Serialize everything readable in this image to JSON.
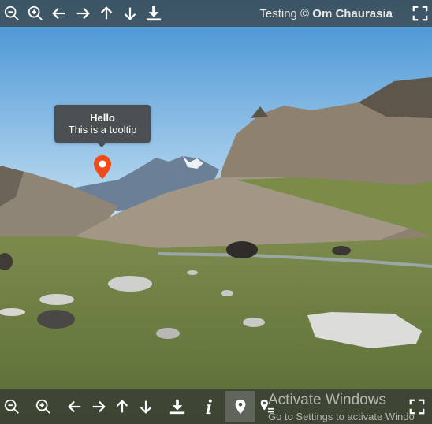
{
  "window": {
    "caption_prefix": "Testing ©",
    "caption_author": "Om Chaurasia"
  },
  "top_toolbar": [
    {
      "name": "zoom-out-button",
      "icon": "zoom-out-icon"
    },
    {
      "name": "zoom-in-button",
      "icon": "zoom-in-icon"
    },
    {
      "name": "move-left-button",
      "icon": "arrow-left-icon"
    },
    {
      "name": "move-right-button",
      "icon": "arrow-right-icon"
    },
    {
      "name": "move-up-button",
      "icon": "arrow-up-icon"
    },
    {
      "name": "move-down-button",
      "icon": "arrow-down-icon"
    },
    {
      "name": "download-button",
      "icon": "download-icon"
    },
    {
      "name": "fullscreen-button",
      "icon": "fullscreen-icon"
    }
  ],
  "bottom_toolbar": [
    {
      "name": "zoom-out-button",
      "icon": "zoom-out-icon"
    },
    {
      "name": "zoom-in-button",
      "icon": "zoom-in-icon"
    },
    {
      "name": "move-left-button",
      "icon": "arrow-left-icon"
    },
    {
      "name": "move-right-button",
      "icon": "arrow-right-icon"
    },
    {
      "name": "move-up-button",
      "icon": "arrow-up-icon"
    },
    {
      "name": "move-down-button",
      "icon": "arrow-down-icon"
    },
    {
      "name": "download-button",
      "icon": "download-icon"
    },
    {
      "name": "info-button",
      "icon": "info-icon"
    },
    {
      "name": "markers-button",
      "icon": "marker-icon",
      "active": true
    },
    {
      "name": "markers-list-button",
      "icon": "marker-list-icon"
    },
    {
      "name": "fullscreen-button",
      "icon": "fullscreen-icon"
    }
  ],
  "tooltip": {
    "title": "Hello",
    "body": "This is a tooltip"
  },
  "marker": {
    "icon": "map-pin-icon",
    "color": "#f04a1a"
  },
  "os_watermark": {
    "title": "Activate Windows",
    "subtitle": "Go to Settings to activate Windo"
  },
  "colors": {
    "sky": "#4f9bd8",
    "navbar": "#3a3e3a",
    "tooltip_bg": "#4a4f52"
  }
}
